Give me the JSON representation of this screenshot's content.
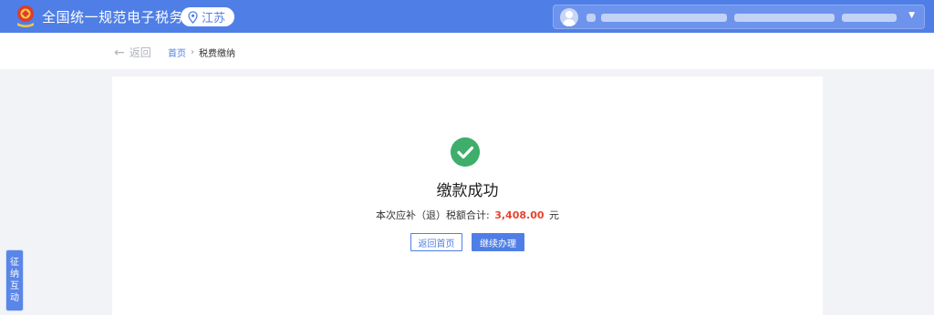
{
  "header": {
    "title": "全国统一规范电子税务局",
    "region": "江苏",
    "logo_icon": "tax-emblem-icon",
    "region_icon": "location-pin-icon",
    "avatar_icon": "user-avatar-icon",
    "dropdown_icon": "caret-down-icon",
    "dropdown_glyph": "▼"
  },
  "breadcrumb": {
    "back_arrow": "←",
    "back_label": "返回",
    "home": "首页",
    "separator": "›",
    "current": "税费缴纳"
  },
  "result": {
    "status_icon": "success-check-icon",
    "title": "缴款成功",
    "summary_prefix": "本次应补（退）税额合计:",
    "amount": "3,408.00",
    "unit": "元",
    "button_home": "返回首页",
    "button_continue": "继续办理"
  },
  "side_tab": {
    "chars": [
      "征",
      "纳",
      "互",
      "动"
    ]
  },
  "colors": {
    "brand": "#4f7fe6",
    "success": "#3fae6b",
    "amount": "#e8432f",
    "background": "#f2f3f7"
  }
}
